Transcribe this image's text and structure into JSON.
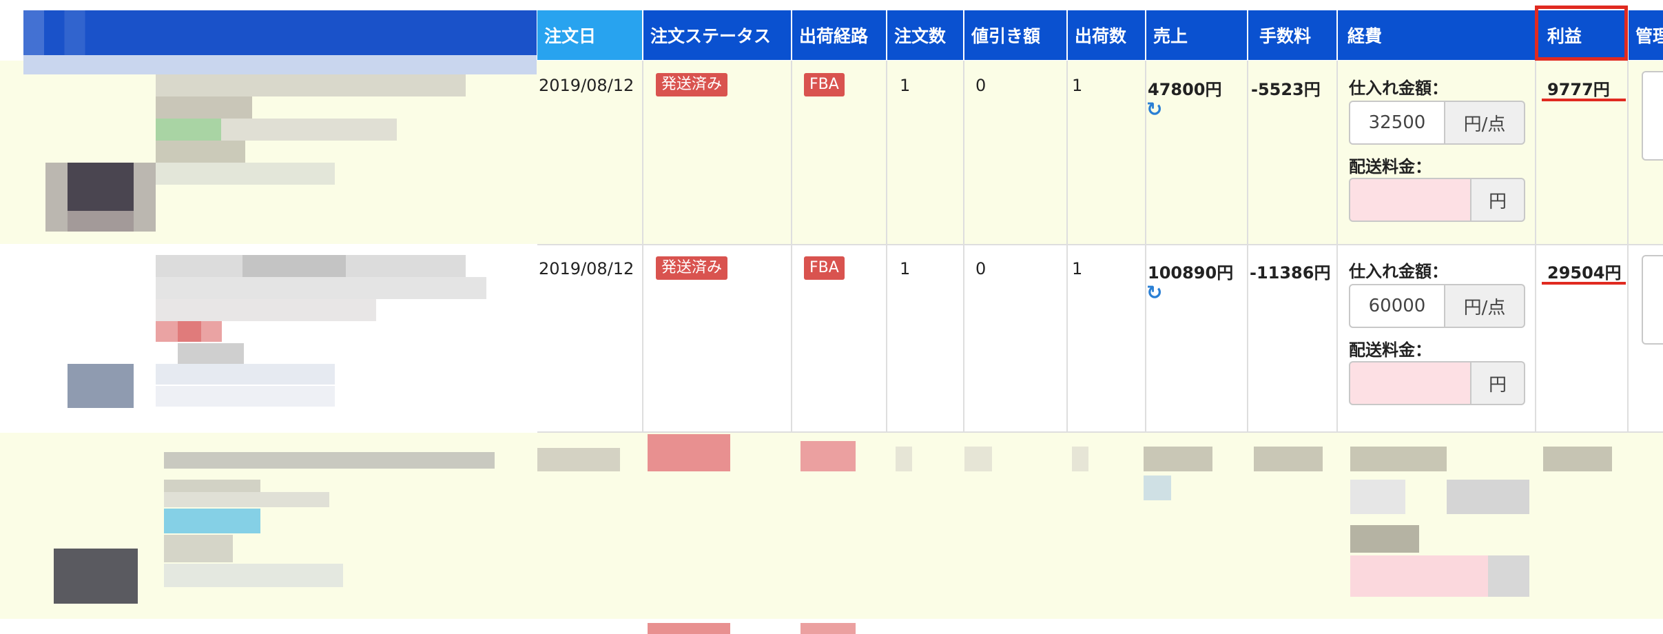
{
  "table": {
    "headers": [
      "注文日",
      "注文ステータス",
      "出荷経路",
      "注文数",
      "値引き額",
      "出荷数",
      "売上",
      "手数料",
      "経費",
      "利益",
      "管理"
    ],
    "expense_labels": {
      "purchase": "仕入れ金額：",
      "shipping": "配送料金："
    },
    "rows": [
      {
        "date": "2019/08/12",
        "status": "発送済み",
        "route": "FBA",
        "qty": "1",
        "discount": "0",
        "shipped": "1",
        "sales": "47800円",
        "fee": "-5523円",
        "purchase_value": "32500",
        "purchase_unit": "円/点",
        "shipping_value": "",
        "shipping_unit": "円",
        "profit": "9777円"
      },
      {
        "date": "2019/08/12",
        "status": "発送済み",
        "route": "FBA",
        "qty": "1",
        "discount": "0",
        "shipped": "1",
        "sales": "100890円",
        "fee": "-11386円",
        "purchase_value": "60000",
        "purchase_unit": "円/点",
        "shipping_value": "",
        "shipping_unit": "円",
        "profit": "29504円"
      }
    ]
  },
  "icons": {
    "refresh": "refresh-icon"
  },
  "colors": {
    "header_bg": "#0a51d0",
    "first_header_bg": "#28a3ef",
    "badge": "#d9534f",
    "highlight": "#e02a20",
    "row_alt": "#fbfde6",
    "refresh": "#2a7fd4"
  }
}
